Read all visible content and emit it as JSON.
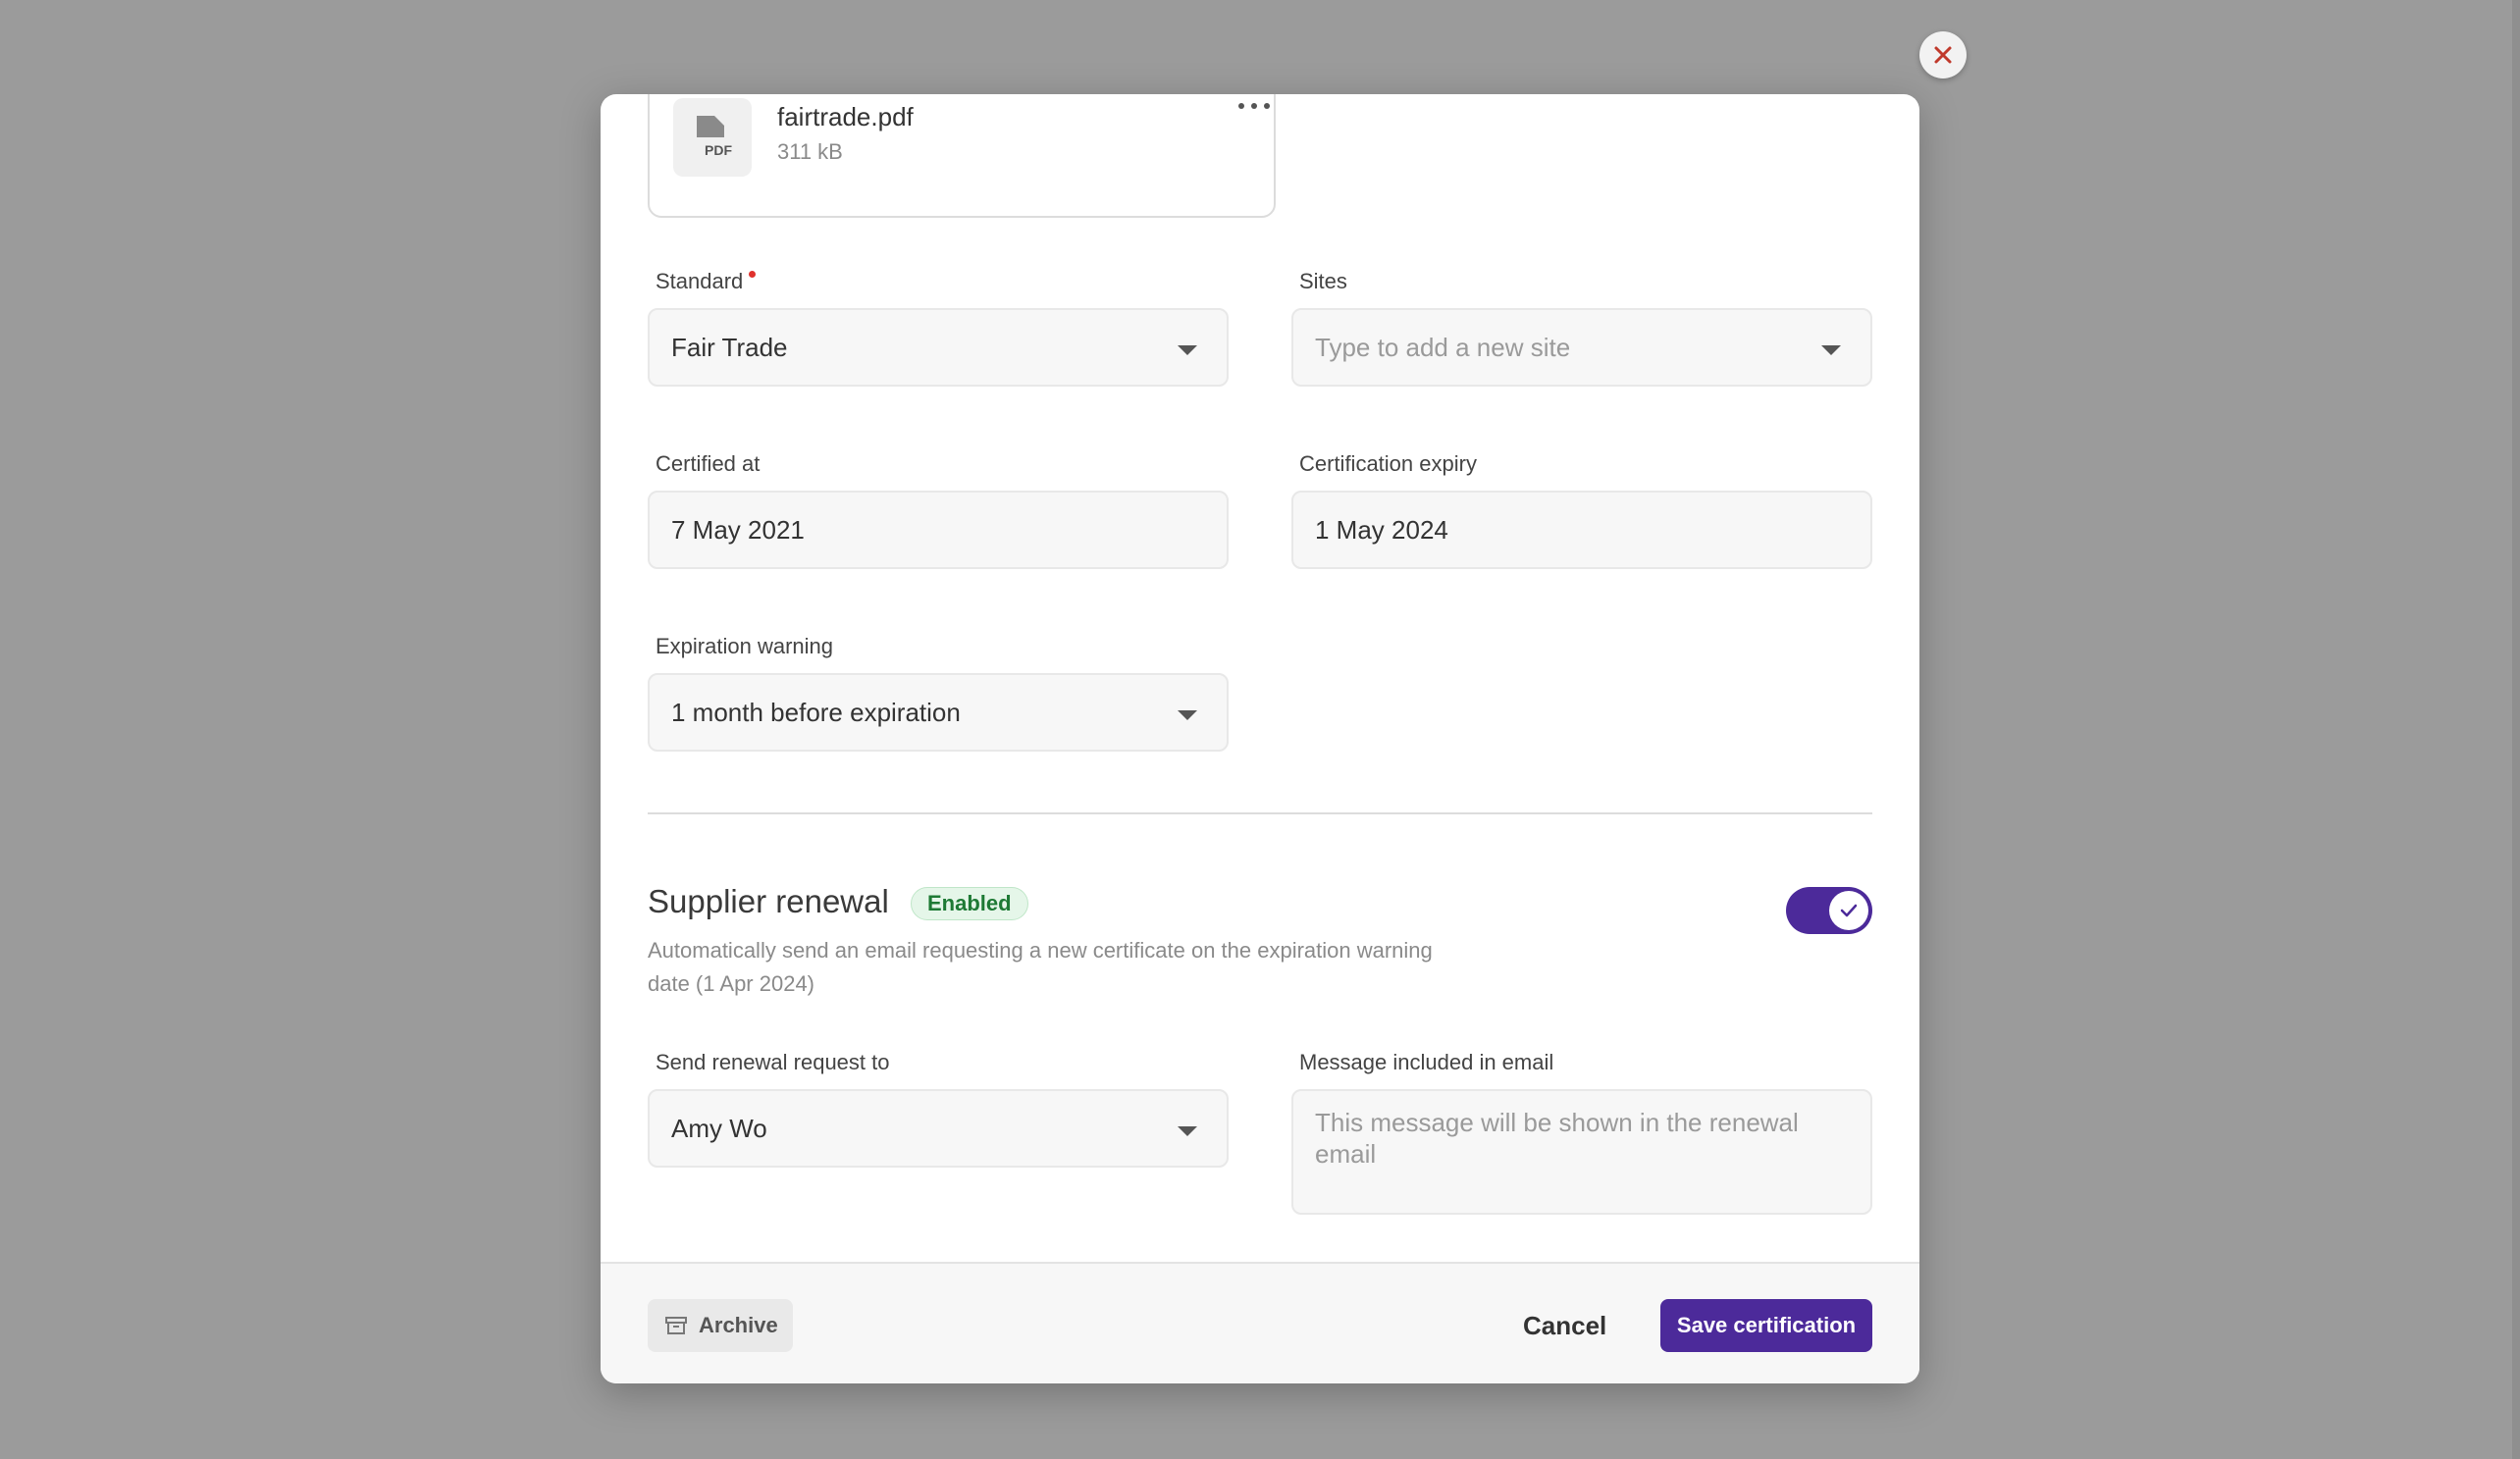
{
  "file": {
    "name": "fairtrade.pdf",
    "size": "311 kB",
    "icon": "pdf-file-icon",
    "icon_text": "PDF"
  },
  "form": {
    "standard": {
      "label": "Standard",
      "value": "Fair Trade"
    },
    "sites": {
      "label": "Sites",
      "placeholder": "Type to add a new site"
    },
    "certified_at": {
      "label": "Certified at",
      "value": "7 May 2021"
    },
    "certification_expiry": {
      "label": "Certification expiry",
      "value": "1 May 2024"
    },
    "expiration_warning": {
      "label": "Expiration warning",
      "value": "1 month before expiration"
    }
  },
  "renewal": {
    "title": "Supplier renewal",
    "badge": "Enabled",
    "description": "Automatically send an email requesting a new certificate on the expiration warning date (1 Apr 2024)",
    "toggle_on": true,
    "send_to": {
      "label": "Send renewal request to",
      "value": "Amy Wo"
    },
    "message": {
      "label": "Message included in email",
      "placeholder": "This message will be shown in the renewal email"
    }
  },
  "footer": {
    "archive_label": "Archive",
    "cancel_label": "Cancel",
    "save_label": "Save certification"
  },
  "colors": {
    "primary": "#4c2a9a",
    "required": "#e0322d",
    "badge_bg": "#e5f6e9",
    "badge_text": "#1e7a35",
    "close_icon": "#c0392b"
  }
}
